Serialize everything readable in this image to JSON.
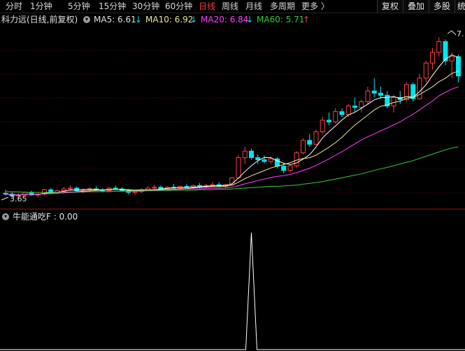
{
  "toolbar": {
    "tabs": [
      {
        "label": "分时",
        "active": false
      },
      {
        "label": "1分钟",
        "active": false
      },
      {
        "label": "5分钟",
        "active": false
      },
      {
        "label": "15分钟",
        "active": false
      },
      {
        "label": "30分钟",
        "active": false
      },
      {
        "label": "60分钟",
        "active": false
      },
      {
        "label": "日线",
        "active": true
      },
      {
        "label": "周线",
        "active": false
      },
      {
        "label": "月线",
        "active": false
      },
      {
        "label": "多周期",
        "active": false
      },
      {
        "label": "更多 〉",
        "active": false
      }
    ],
    "right_buttons": [
      "复权",
      "叠加",
      "多股",
      "统计"
    ]
  },
  "legend": {
    "stock": "科力远(日线,前复权)",
    "ma5": "MA5: 6.61",
    "ma10": "MA10: 6.92",
    "ma20": "MA20: 6.84",
    "ma60": "MA60: 5.71",
    "ma5_arrow": "↓",
    "ma10_arrow": "↓",
    "ma20_arrow": "↓",
    "ma60_arrow": "↑"
  },
  "price_labels": {
    "high": "7.",
    "low": "3.65"
  },
  "indicator": {
    "label": "牛能通吃F : 0.00"
  },
  "colors": {
    "up": "#ff4040",
    "down": "#00e5ee",
    "ma5": "#ffffff",
    "ma10": "#f0e68c",
    "ma20": "#ff40ff",
    "ma60": "#33cc33",
    "active_tab": "#ff3b3b"
  },
  "chart_data": {
    "type": "candlestick",
    "y_range": [
      3.4,
      7.6
    ],
    "candles": [
      [
        3.72,
        3.8,
        3.66,
        3.7
      ],
      [
        3.7,
        3.74,
        3.62,
        3.66
      ],
      [
        3.66,
        3.72,
        3.6,
        3.68
      ],
      [
        3.68,
        3.76,
        3.64,
        3.74
      ],
      [
        3.74,
        3.78,
        3.66,
        3.68
      ],
      [
        3.68,
        3.72,
        3.62,
        3.7
      ],
      [
        3.7,
        3.82,
        3.68,
        3.8
      ],
      [
        3.8,
        3.84,
        3.72,
        3.74
      ],
      [
        3.74,
        3.8,
        3.7,
        3.78
      ],
      [
        3.78,
        3.86,
        3.74,
        3.82
      ],
      [
        3.82,
        3.9,
        3.78,
        3.84
      ],
      [
        3.84,
        3.88,
        3.76,
        3.78
      ],
      [
        3.78,
        3.84,
        3.72,
        3.8
      ],
      [
        3.8,
        3.86,
        3.76,
        3.82
      ],
      [
        3.82,
        3.88,
        3.78,
        3.8
      ],
      [
        3.8,
        3.84,
        3.74,
        3.78
      ],
      [
        3.78,
        3.86,
        3.74,
        3.84
      ],
      [
        3.84,
        3.9,
        3.8,
        3.82
      ],
      [
        3.82,
        3.86,
        3.76,
        3.78
      ],
      [
        3.78,
        3.82,
        3.7,
        3.74
      ],
      [
        3.74,
        3.8,
        3.68,
        3.76
      ],
      [
        3.76,
        3.84,
        3.72,
        3.8
      ],
      [
        3.8,
        3.88,
        3.78,
        3.84
      ],
      [
        3.84,
        3.92,
        3.8,
        3.86
      ],
      [
        3.86,
        3.9,
        3.8,
        3.82
      ],
      [
        3.82,
        3.88,
        3.78,
        3.86
      ],
      [
        3.86,
        3.94,
        3.82,
        3.84
      ],
      [
        3.84,
        3.9,
        3.8,
        3.88
      ],
      [
        3.88,
        3.94,
        3.84,
        3.86
      ],
      [
        3.86,
        3.92,
        3.82,
        3.9
      ],
      [
        3.9,
        3.96,
        3.84,
        3.88
      ],
      [
        3.88,
        3.94,
        3.84,
        3.9
      ],
      [
        3.9,
        3.98,
        3.86,
        3.92
      ],
      [
        3.92,
        3.98,
        3.86,
        3.88
      ],
      [
        3.88,
        3.94,
        3.84,
        3.92
      ],
      [
        3.92,
        4.1,
        3.9,
        4.08
      ],
      [
        4.08,
        4.6,
        4.06,
        4.55
      ],
      [
        4.55,
        4.8,
        4.4,
        4.7
      ],
      [
        4.7,
        4.76,
        4.5,
        4.55
      ],
      [
        4.55,
        4.62,
        4.4,
        4.5
      ],
      [
        4.5,
        4.6,
        4.42,
        4.46
      ],
      [
        4.46,
        4.58,
        4.4,
        4.52
      ],
      [
        4.52,
        4.56,
        4.3,
        4.35
      ],
      [
        4.35,
        4.42,
        4.18,
        4.25
      ],
      [
        4.25,
        4.4,
        4.2,
        4.36
      ],
      [
        4.36,
        4.7,
        4.32,
        4.66
      ],
      [
        4.66,
        5.0,
        4.62,
        4.95
      ],
      [
        4.95,
        5.1,
        4.8,
        4.86
      ],
      [
        4.86,
        5.2,
        4.84,
        5.15
      ],
      [
        5.15,
        5.5,
        5.1,
        5.42
      ],
      [
        5.42,
        5.6,
        5.3,
        5.38
      ],
      [
        5.38,
        5.7,
        5.34,
        5.62
      ],
      [
        5.62,
        5.7,
        5.5,
        5.55
      ],
      [
        5.55,
        5.8,
        5.5,
        5.75
      ],
      [
        5.75,
        5.95,
        5.6,
        5.72
      ],
      [
        5.72,
        5.9,
        5.6,
        5.85
      ],
      [
        5.85,
        6.2,
        5.8,
        6.1
      ],
      [
        6.1,
        6.4,
        5.95,
        6.05
      ],
      [
        6.05,
        6.2,
        5.92,
        6.0
      ],
      [
        6.0,
        6.1,
        5.7,
        5.75
      ],
      [
        5.75,
        6.0,
        5.6,
        5.95
      ],
      [
        5.95,
        6.1,
        5.8,
        5.9
      ],
      [
        5.9,
        6.3,
        5.85,
        6.25
      ],
      [
        6.25,
        6.3,
        5.85,
        5.92
      ],
      [
        5.92,
        6.5,
        5.9,
        6.4
      ],
      [
        6.4,
        6.8,
        6.3,
        6.75
      ],
      [
        6.75,
        7.1,
        6.6,
        7.0
      ],
      [
        7.0,
        7.35,
        6.9,
        7.25
      ],
      [
        7.25,
        7.3,
        6.7,
        6.8
      ],
      [
        6.8,
        7.0,
        6.4,
        6.9
      ],
      [
        6.9,
        6.95,
        6.3,
        6.45
      ]
    ],
    "ma60": [
      3.76,
      3.75,
      3.75,
      3.74,
      3.74,
      3.74,
      3.74,
      3.74,
      3.74,
      3.75,
      3.75,
      3.75,
      3.75,
      3.76,
      3.76,
      3.76,
      3.76,
      3.77,
      3.77,
      3.77,
      3.77,
      3.77,
      3.78,
      3.78,
      3.78,
      3.78,
      3.79,
      3.79,
      3.79,
      3.79,
      3.8,
      3.8,
      3.8,
      3.81,
      3.81,
      3.82,
      3.83,
      3.84,
      3.85,
      3.86,
      3.87,
      3.88,
      3.88,
      3.89,
      3.9,
      3.91,
      3.93,
      3.95,
      3.97,
      3.99,
      4.02,
      4.05,
      4.08,
      4.11,
      4.14,
      4.17,
      4.21,
      4.25,
      4.29,
      4.32,
      4.36,
      4.4,
      4.44,
      4.48,
      4.53,
      4.58,
      4.63,
      4.68,
      4.73,
      4.77,
      4.8
    ],
    "indicator": {
      "spike_index": 38,
      "spike_value": 1,
      "y_range": [
        0,
        1.1
      ]
    }
  }
}
